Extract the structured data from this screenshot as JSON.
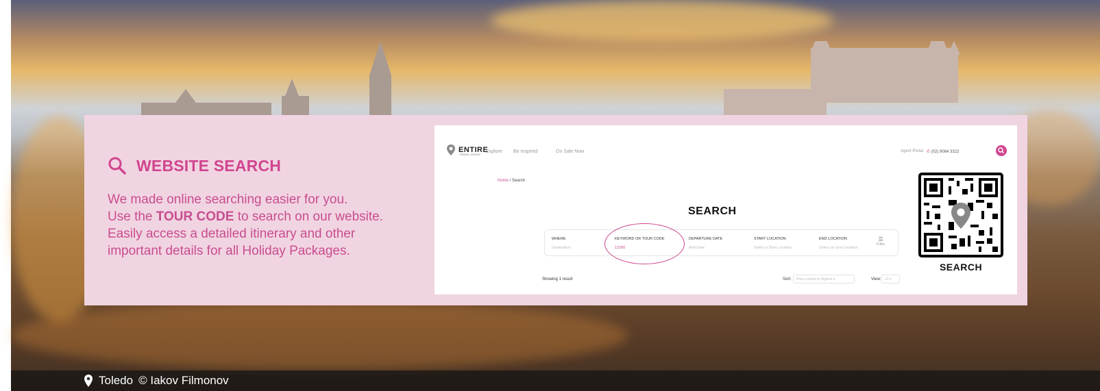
{
  "card": {
    "title": "WEBSITE SEARCH",
    "desc_line1": "We made online searching easier for you.",
    "desc_line2_pre": "Use the ",
    "desc_line2_bold": "TOUR CODE",
    "desc_line2_post": " to search on our website.",
    "desc_line3": "Easily access a detailed itinerary and other",
    "desc_line4": "important details for all Holiday Packages."
  },
  "screenshot": {
    "logo_name": "ENTIRE",
    "logo_sub": "TRAVEL GROUP",
    "nav": [
      "Explore",
      "Be Inspired",
      "On Sale Now"
    ],
    "agent": "Agent Portal",
    "phone": "(02) 9064 3322",
    "breadcrumb_home": "Home",
    "breadcrumb_sep": " / ",
    "breadcrumb_current": "Search",
    "page_title": "SEARCH",
    "fields": [
      {
        "label": "WHERE",
        "value": "Destination"
      },
      {
        "label": "KEYWORD OR TOUR CODE",
        "value": "12290"
      },
      {
        "label": "DEPARTURE DATE",
        "value": "Add Date"
      },
      {
        "label": "START LOCATION",
        "value": "Select a Start Location"
      },
      {
        "label": "END LOCATION",
        "value": "Select an End Location"
      }
    ],
    "filter_label": "Filter",
    "showing": "Showing 1 result",
    "sort_label": "Sort:",
    "sort_value": "Price Lowest to Highest",
    "view_label": "View:",
    "view_value": "10"
  },
  "qr": {
    "label": "SEARCH"
  },
  "credit": {
    "location": "Toledo",
    "author": "© Iakov Filmonov"
  },
  "colors": {
    "accent": "#d0458f",
    "card_bg": "#f1d4e1"
  }
}
